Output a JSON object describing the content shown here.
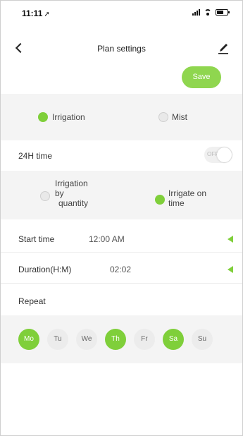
{
  "status_bar": {
    "time": "11:11",
    "location_glyph": "➚"
  },
  "header": {
    "title": "Plan settings",
    "back_icon": "chevron-left-icon",
    "edit_icon": "edit-pencil-icon"
  },
  "actions": {
    "save_label": "Save"
  },
  "mode": {
    "options": [
      {
        "label": "Irrigation",
        "selected": true
      },
      {
        "label": "Mist",
        "selected": false
      }
    ]
  },
  "time_24h": {
    "label": "24H time",
    "toggle_text": "OFF",
    "enabled": false
  },
  "irrigation_type": {
    "quantity": {
      "line1": "Irrigation",
      "line2": "by",
      "line3": "quantity",
      "selected": false
    },
    "time": {
      "line1": "Irrigate on",
      "line2": "time",
      "selected": true
    }
  },
  "start_time": {
    "label": "Start time",
    "value": "12:00 AM"
  },
  "duration": {
    "label": "Duration(H:M)",
    "value": "02:02"
  },
  "repeat": {
    "label": "Repeat"
  },
  "days": [
    {
      "label": "Mo",
      "on": true
    },
    {
      "label": "Tu",
      "on": false
    },
    {
      "label": "We",
      "on": false
    },
    {
      "label": "Th",
      "on": true
    },
    {
      "label": "Fr",
      "on": false
    },
    {
      "label": "Sa",
      "on": true
    },
    {
      "label": "Su",
      "on": false
    }
  ],
  "colors": {
    "accent": "#7fcf3a",
    "save_button": "#8fd64f",
    "band": "#f4f4f4"
  }
}
